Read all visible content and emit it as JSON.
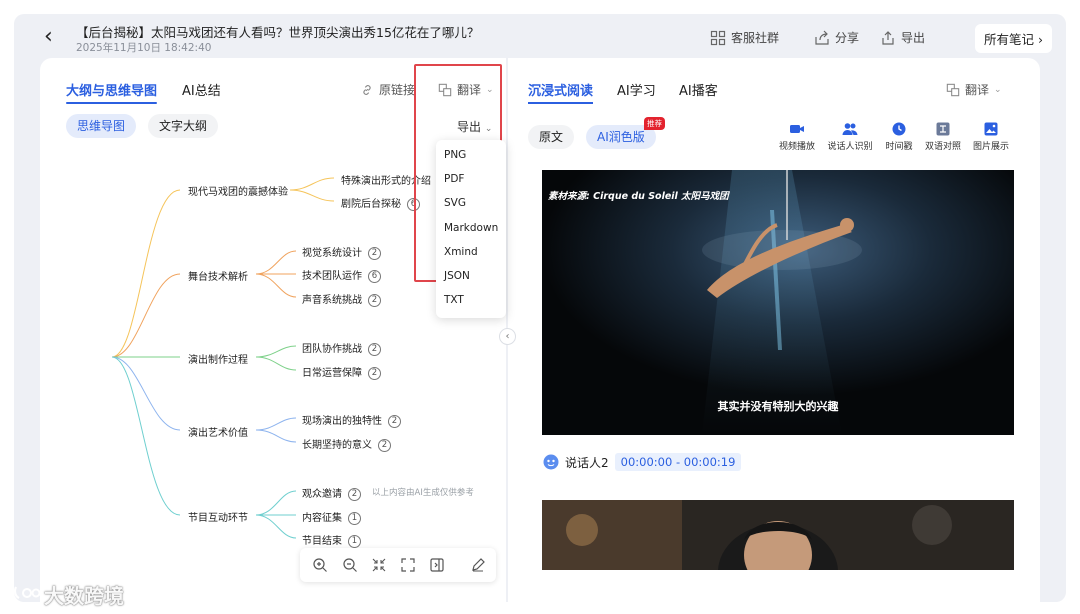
{
  "header": {
    "title": "【后台揭秘】太阳马戏团还有人看吗？世界顶尖演出秀15亿花在了哪儿？",
    "date": "2025年11月10日 18:42:40",
    "service_label": "客服社群",
    "share_label": "分享",
    "export_label": "导出",
    "all_notes_label": "所有笔记"
  },
  "left_panel": {
    "tabs": [
      {
        "label": "大纲与思维导图",
        "active": true
      },
      {
        "label": "AI总结",
        "active": false
      }
    ],
    "source_link_label": "原链接",
    "translate_label": "翻译",
    "view_pills": [
      "思维导图",
      "文字大纲"
    ],
    "export_button_label": "导出",
    "export_options": [
      "PNG",
      "PDF",
      "SVG",
      "Markdown",
      "Xmind",
      "JSON",
      "TXT"
    ],
    "disclaimer": "以上内容由AI生成仅供参考"
  },
  "mindmap": {
    "branches": [
      {
        "label": "现代马戏团的震撼体验",
        "color": "#f5c45a",
        "children": [
          {
            "label": "特殊演出形式的介绍",
            "count": ""
          },
          {
            "label": "剧院后台探秘",
            "count": "6"
          }
        ]
      },
      {
        "label": "舞台技术解析",
        "color": "#f0a35e",
        "children": [
          {
            "label": "视觉系统设计",
            "count": "2"
          },
          {
            "label": "技术团队运作",
            "count": "6"
          },
          {
            "label": "声音系统挑战",
            "count": "2"
          }
        ]
      },
      {
        "label": "演出制作过程",
        "color": "#7ed18a",
        "children": [
          {
            "label": "团队协作挑战",
            "count": "2"
          },
          {
            "label": "日常运营保障",
            "count": "2"
          }
        ]
      },
      {
        "label": "演出艺术价值",
        "color": "#8eb4ee",
        "children": [
          {
            "label": "现场演出的独特性",
            "count": "2"
          },
          {
            "label": "长期坚持的意义",
            "count": "2"
          }
        ]
      },
      {
        "label": "节目互动环节",
        "color": "#6fcfcf",
        "children": [
          {
            "label": "观众邀请",
            "count": "2"
          },
          {
            "label": "内容征集",
            "count": "1"
          },
          {
            "label": "节目结束",
            "count": "1"
          }
        ]
      }
    ]
  },
  "right_panel": {
    "tabs": [
      {
        "label": "沉浸式阅读",
        "active": true
      },
      {
        "label": "AI学习",
        "active": false
      },
      {
        "label": "AI播客",
        "active": false
      }
    ],
    "translate_label": "翻译",
    "mode_pills": [
      "原文",
      "AI润色版"
    ],
    "hot_badge": "推荐",
    "tools": [
      {
        "label": "视频播放",
        "icon": "video-icon"
      },
      {
        "label": "说话人识别",
        "icon": "people-icon"
      },
      {
        "label": "时间戳",
        "icon": "clock-icon"
      },
      {
        "label": "双语对照",
        "icon": "bilingual-icon"
      },
      {
        "label": "图片展示",
        "icon": "image-icon"
      }
    ],
    "video_source": "素材来源: Cirque du Soleil 太阳马戏团",
    "video_subtitle": "其实并没有特别大的兴趣",
    "speaker_label": "说话人2",
    "timestamp": "00:00:00 - 00:00:19"
  },
  "watermark": "大数跨境",
  "colors": {
    "accent": "#2b5fe0",
    "highlight_red": "#e0454b",
    "hot_red": "#e3232e"
  }
}
